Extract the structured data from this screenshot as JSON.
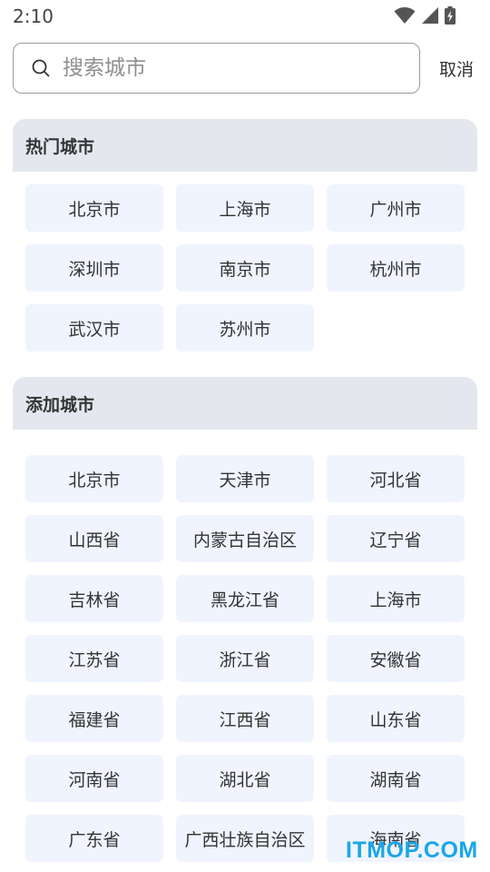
{
  "status_bar": {
    "time": "2:10",
    "icons": [
      "wifi-icon",
      "signal-icon",
      "battery-charging-icon"
    ]
  },
  "search": {
    "placeholder": "搜索城市",
    "value": "",
    "cancel_label": "取消"
  },
  "hot_cities": {
    "title": "热门城市",
    "items": [
      "北京市",
      "上海市",
      "广州市",
      "深圳市",
      "南京市",
      "杭州市",
      "武汉市",
      "苏州市"
    ]
  },
  "add_cities": {
    "title": "添加城市",
    "items": [
      "北京市",
      "天津市",
      "河北省",
      "山西省",
      "内蒙古自治区",
      "辽宁省",
      "吉林省",
      "黑龙江省",
      "上海市",
      "江苏省",
      "浙江省",
      "安徽省",
      "福建省",
      "江西省",
      "山东省",
      "河南省",
      "湖北省",
      "湖南省",
      "广东省",
      "广西壮族自治区",
      "海南省"
    ]
  },
  "watermark": "ITMOP.COM",
  "colors": {
    "chip_bg": "#f0f4fe",
    "header_bg": "#e4e8ee",
    "watermark": "#1aa6e8"
  }
}
